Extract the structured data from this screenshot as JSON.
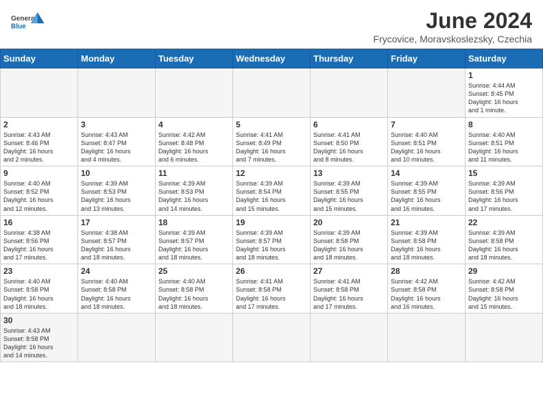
{
  "header": {
    "logo_text_general": "General",
    "logo_text_blue": "Blue",
    "month_title": "June 2024",
    "subtitle": "Frycovice, Moravskoslezsky, Czechia"
  },
  "days_of_week": [
    "Sunday",
    "Monday",
    "Tuesday",
    "Wednesday",
    "Thursday",
    "Friday",
    "Saturday"
  ],
  "weeks": [
    [
      {
        "day": "",
        "info": ""
      },
      {
        "day": "",
        "info": ""
      },
      {
        "day": "",
        "info": ""
      },
      {
        "day": "",
        "info": ""
      },
      {
        "day": "",
        "info": ""
      },
      {
        "day": "",
        "info": ""
      },
      {
        "day": "1",
        "info": "Sunrise: 4:44 AM\nSunset: 8:45 PM\nDaylight: 16 hours\nand 1 minute."
      }
    ],
    [
      {
        "day": "2",
        "info": "Sunrise: 4:43 AM\nSunset: 8:46 PM\nDaylight: 16 hours\nand 2 minutes."
      },
      {
        "day": "3",
        "info": "Sunrise: 4:43 AM\nSunset: 8:47 PM\nDaylight: 16 hours\nand 4 minutes."
      },
      {
        "day": "4",
        "info": "Sunrise: 4:42 AM\nSunset: 8:48 PM\nDaylight: 16 hours\nand 6 minutes."
      },
      {
        "day": "5",
        "info": "Sunrise: 4:41 AM\nSunset: 8:49 PM\nDaylight: 16 hours\nand 7 minutes."
      },
      {
        "day": "6",
        "info": "Sunrise: 4:41 AM\nSunset: 8:50 PM\nDaylight: 16 hours\nand 8 minutes."
      },
      {
        "day": "7",
        "info": "Sunrise: 4:40 AM\nSunset: 8:51 PM\nDaylight: 16 hours\nand 10 minutes."
      },
      {
        "day": "8",
        "info": "Sunrise: 4:40 AM\nSunset: 8:51 PM\nDaylight: 16 hours\nand 11 minutes."
      }
    ],
    [
      {
        "day": "9",
        "info": "Sunrise: 4:40 AM\nSunset: 8:52 PM\nDaylight: 16 hours\nand 12 minutes."
      },
      {
        "day": "10",
        "info": "Sunrise: 4:39 AM\nSunset: 8:53 PM\nDaylight: 16 hours\nand 13 minutes."
      },
      {
        "day": "11",
        "info": "Sunrise: 4:39 AM\nSunset: 8:53 PM\nDaylight: 16 hours\nand 14 minutes."
      },
      {
        "day": "12",
        "info": "Sunrise: 4:39 AM\nSunset: 8:54 PM\nDaylight: 16 hours\nand 15 minutes."
      },
      {
        "day": "13",
        "info": "Sunrise: 4:39 AM\nSunset: 8:55 PM\nDaylight: 16 hours\nand 15 minutes."
      },
      {
        "day": "14",
        "info": "Sunrise: 4:39 AM\nSunset: 8:55 PM\nDaylight: 16 hours\nand 16 minutes."
      },
      {
        "day": "15",
        "info": "Sunrise: 4:39 AM\nSunset: 8:56 PM\nDaylight: 16 hours\nand 17 minutes."
      }
    ],
    [
      {
        "day": "16",
        "info": "Sunrise: 4:38 AM\nSunset: 8:56 PM\nDaylight: 16 hours\nand 17 minutes."
      },
      {
        "day": "17",
        "info": "Sunrise: 4:38 AM\nSunset: 8:57 PM\nDaylight: 16 hours\nand 18 minutes."
      },
      {
        "day": "18",
        "info": "Sunrise: 4:39 AM\nSunset: 8:57 PM\nDaylight: 16 hours\nand 18 minutes."
      },
      {
        "day": "19",
        "info": "Sunrise: 4:39 AM\nSunset: 8:57 PM\nDaylight: 16 hours\nand 18 minutes."
      },
      {
        "day": "20",
        "info": "Sunrise: 4:39 AM\nSunset: 8:58 PM\nDaylight: 16 hours\nand 18 minutes."
      },
      {
        "day": "21",
        "info": "Sunrise: 4:39 AM\nSunset: 8:58 PM\nDaylight: 16 hours\nand 18 minutes."
      },
      {
        "day": "22",
        "info": "Sunrise: 4:39 AM\nSunset: 8:58 PM\nDaylight: 16 hours\nand 18 minutes."
      }
    ],
    [
      {
        "day": "23",
        "info": "Sunrise: 4:40 AM\nSunset: 8:58 PM\nDaylight: 16 hours\nand 18 minutes."
      },
      {
        "day": "24",
        "info": "Sunrise: 4:40 AM\nSunset: 8:58 PM\nDaylight: 16 hours\nand 18 minutes."
      },
      {
        "day": "25",
        "info": "Sunrise: 4:40 AM\nSunset: 8:58 PM\nDaylight: 16 hours\nand 18 minutes."
      },
      {
        "day": "26",
        "info": "Sunrise: 4:41 AM\nSunset: 8:58 PM\nDaylight: 16 hours\nand 17 minutes."
      },
      {
        "day": "27",
        "info": "Sunrise: 4:41 AM\nSunset: 8:58 PM\nDaylight: 16 hours\nand 17 minutes."
      },
      {
        "day": "28",
        "info": "Sunrise: 4:42 AM\nSunset: 8:58 PM\nDaylight: 16 hours\nand 16 minutes."
      },
      {
        "day": "29",
        "info": "Sunrise: 4:42 AM\nSunset: 8:58 PM\nDaylight: 16 hours\nand 15 minutes."
      }
    ],
    [
      {
        "day": "30",
        "info": "Sunrise: 4:43 AM\nSunset: 8:58 PM\nDaylight: 16 hours\nand 14 minutes."
      },
      {
        "day": "",
        "info": ""
      },
      {
        "day": "",
        "info": ""
      },
      {
        "day": "",
        "info": ""
      },
      {
        "day": "",
        "info": ""
      },
      {
        "day": "",
        "info": ""
      },
      {
        "day": "",
        "info": ""
      }
    ]
  ]
}
